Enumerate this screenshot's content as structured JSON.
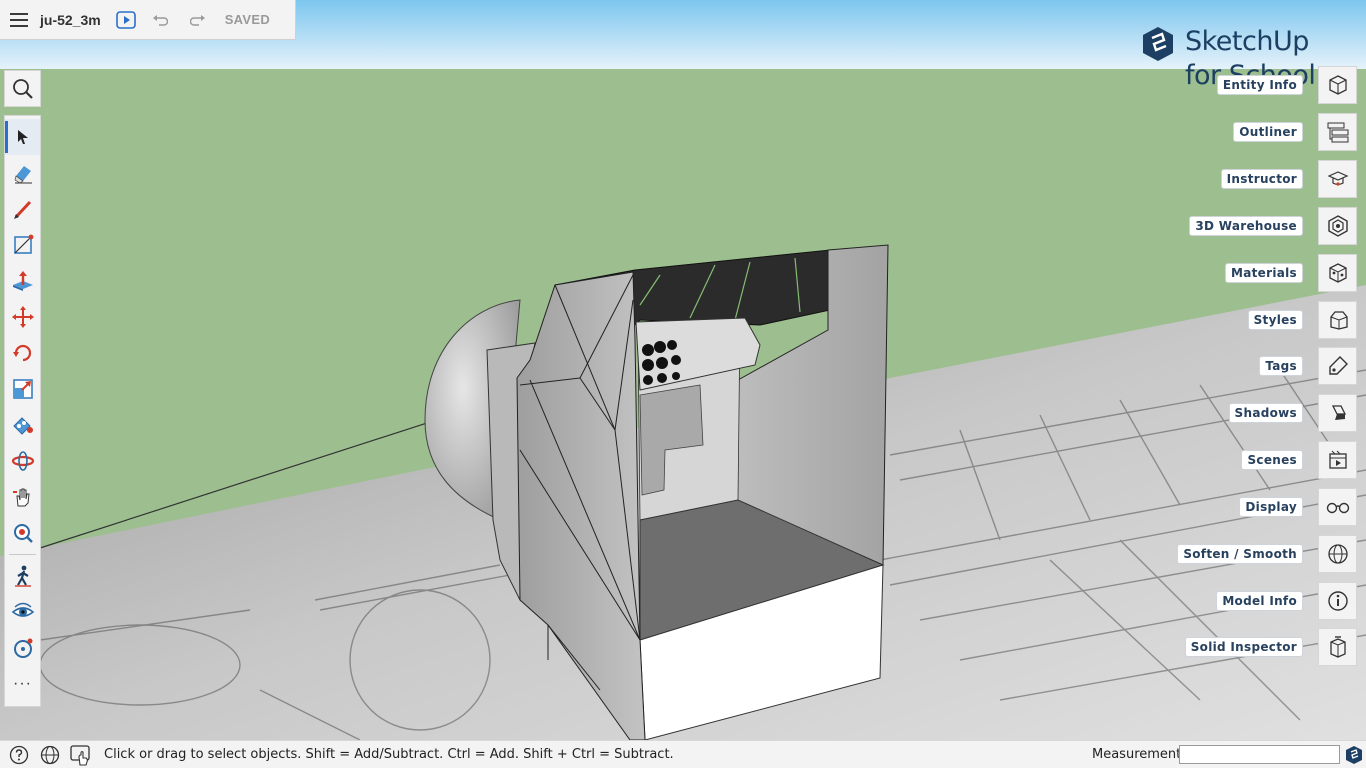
{
  "topbar": {
    "model_name": "ju-52_3m",
    "status": "SAVED",
    "icons": [
      "menu-icon",
      "play-icon",
      "undo-icon",
      "redo-icon"
    ]
  },
  "logo": {
    "line1": "SketchUp",
    "line2": "for School"
  },
  "left_toolbar": {
    "search_icon": "search-icon",
    "tools": [
      {
        "name": "select-tool",
        "icon": "arrow-icon",
        "active": true
      },
      {
        "name": "eraser-tool",
        "icon": "eraser-icon"
      },
      {
        "name": "pencil-tool",
        "icon": "pencil-icon"
      },
      {
        "name": "line-tool",
        "icon": "line-icon"
      },
      {
        "name": "push-pull-tool",
        "icon": "push-pull-icon"
      },
      {
        "name": "move-tool",
        "icon": "move-icon"
      },
      {
        "name": "rotate-tool",
        "icon": "rotate-icon"
      },
      {
        "name": "scale-tool",
        "icon": "scale-icon"
      },
      {
        "name": "paint-bucket-tool",
        "icon": "paint-bucket-icon"
      },
      {
        "name": "orbit-tool",
        "icon": "orbit-icon"
      },
      {
        "name": "pan-tool",
        "icon": "hand-icon"
      },
      {
        "name": "zoom-tool",
        "icon": "zoom-pin-icon"
      },
      {
        "name": "walk-tool",
        "icon": "walk-icon"
      },
      {
        "name": "look-around-tool",
        "icon": "eye-icon"
      },
      {
        "name": "position-camera-tool",
        "icon": "camera-position-icon"
      }
    ],
    "more_label": "···"
  },
  "right_panel": {
    "items": [
      {
        "label": "Entity Info",
        "icon": "cube-info-icon"
      },
      {
        "label": "Outliner",
        "icon": "outliner-icon"
      },
      {
        "label": "Instructor",
        "icon": "graduation-cap-icon"
      },
      {
        "label": "3D Warehouse",
        "icon": "warehouse-icon"
      },
      {
        "label": "Materials",
        "icon": "materials-cube-icon"
      },
      {
        "label": "Styles",
        "icon": "styles-icon"
      },
      {
        "label": "Tags",
        "icon": "tag-icon"
      },
      {
        "label": "Shadows",
        "icon": "shadow-icon"
      },
      {
        "label": "Scenes",
        "icon": "scenes-icon"
      },
      {
        "label": "Display",
        "icon": "glasses-icon"
      },
      {
        "label": "Soften / Smooth",
        "icon": "globe-mesh-icon"
      },
      {
        "label": "Model Info",
        "icon": "info-icon"
      },
      {
        "label": "Solid Inspector",
        "icon": "solid-inspector-icon"
      }
    ]
  },
  "statusbar": {
    "hint": "Click or drag to select objects. Shift = Add/Subtract. Ctrl = Add. Shift + Ctrl = Subtract.",
    "measurements_label": "Measurements",
    "measurements_value": "",
    "icons": [
      "help-icon",
      "globe-icon",
      "touch-icon",
      "sketchup-logo-icon"
    ]
  },
  "colors": {
    "sky": "#8fd0f0",
    "ground": "#9dbf8f",
    "accent": "#2a6fc9",
    "panel_text": "#27415e",
    "logo": "#1c3f63"
  }
}
